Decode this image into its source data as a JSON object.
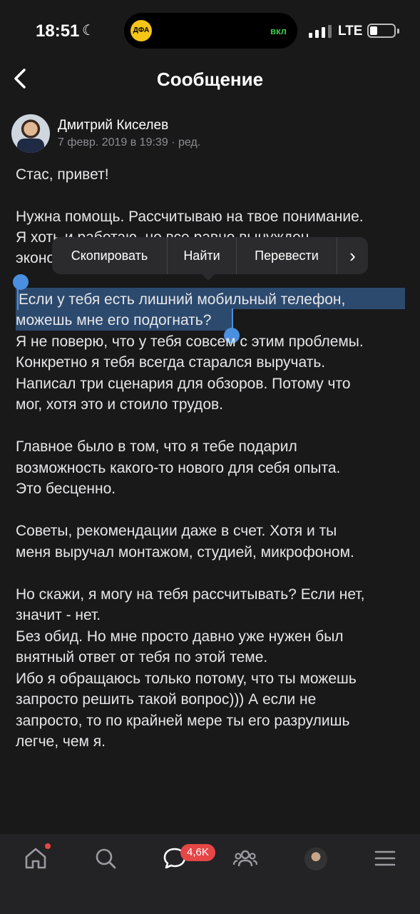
{
  "status": {
    "time": "18:51",
    "island_label": "вкл",
    "island_icon_text": "ДФА",
    "network": "LTE"
  },
  "header": {
    "title": "Сообщение"
  },
  "post": {
    "author": "Дмитрий Киселев",
    "meta": "7 февр. 2019 в 19:39 · ред.",
    "greeting": "Стас, привет!",
    "lines_p1": [
      "Нужна помощь. Рассчитываю на твое понимание.",
      "Я хоть и работаю, но все равно вынужден",
      "эконо"
    ],
    "selected_1": "Если у тебя есть лишний мобильный телефон,",
    "selected_2": "можешь мне его подогнать?",
    "lines_p2": [
      "Я не поверю, что у тебя совсем с этим проблемы.",
      "Конкретно я тебя всегда старался выручать.",
      "Написал три сценария для обзоров. Потому что",
      "мог, хотя это и стоило трудов."
    ],
    "lines_p3": [
      "Главное было в том, что я тебе подарил",
      "возможность какого-то нового для себя опыта.",
      "Это бесценно."
    ],
    "lines_p4": [
      "Советы, рекомендации даже в счет. Хотя и ты",
      "меня выручал монтажом, студией, микрофоном."
    ],
    "lines_p5": [
      "Но скажи, я могу на тебя рассчитывать? Если нет,",
      "значит - нет.",
      "Без обид. Но мне просто давно уже нужен был",
      "внятный ответ от тебя по этой теме.",
      "Ибо я обращаюсь только потому, что ты можешь",
      "запросто решить такой вопрос))) А если не",
      "запросто, то по крайней мере ты его разрулишь",
      "легче, чем я."
    ]
  },
  "context_menu": {
    "copy": "Скопировать",
    "find": "Найти",
    "translate": "Перевести",
    "more": "›"
  },
  "nav": {
    "messages_badge": "4,6K",
    "items": [
      "home-icon",
      "search-icon",
      "messages-icon",
      "friends-icon",
      "profile-avatar",
      "menu-icon"
    ]
  },
  "colors": {
    "background": "#19191a",
    "selection": "#2c4a6e",
    "handle": "#4b8fe0",
    "badge": "#e64646"
  }
}
